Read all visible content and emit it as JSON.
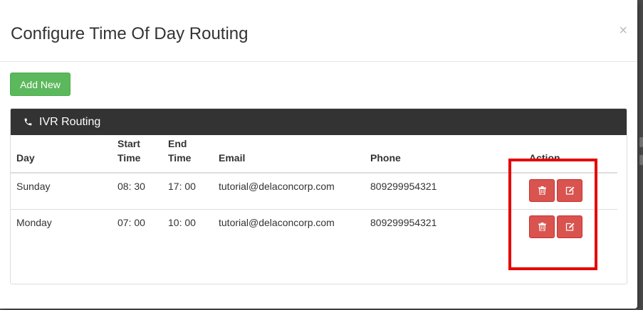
{
  "modal": {
    "title": "Configure Time Of Day Routing",
    "close_label": "×"
  },
  "toolbar": {
    "add_new_label": "Add New"
  },
  "panel": {
    "title": "IVR Routing",
    "icon": "phone-icon"
  },
  "table": {
    "headers": {
      "day": "Day",
      "start_time_1": "Start",
      "start_time_2": "Time",
      "end_time_1": "End",
      "end_time_2": "Time",
      "email": "Email",
      "phone": "Phone",
      "action": "Action"
    },
    "rows": [
      {
        "day": "Sunday",
        "start": "08: 30",
        "end": "17: 00",
        "email": "tutorial@delaconcorp.com",
        "phone": "809299954321"
      },
      {
        "day": "Monday",
        "start": "07: 00",
        "end": "10: 00",
        "email": "tutorial@delaconcorp.com",
        "phone": "809299954321"
      }
    ],
    "action_icons": [
      "trash-icon",
      "edit-icon"
    ]
  },
  "colors": {
    "success": "#5cb85c",
    "danger": "#d9534f",
    "panel_heading": "#333333",
    "highlight": "#e60000"
  }
}
